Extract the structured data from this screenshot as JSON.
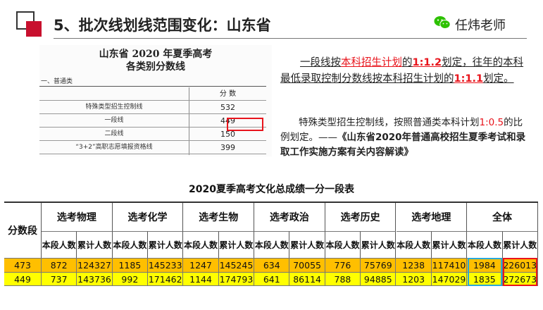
{
  "header": {
    "title": "5、批次线划线范围变化：山东省",
    "author": "任炜老师"
  },
  "doc": {
    "title_line1": "山东省 2020 年夏季高考",
    "title_line2": "各类别分数线",
    "section": "一、普通类",
    "col_header": "分 数",
    "rows": [
      {
        "label": "特殊类型招生控制线",
        "value": "532"
      },
      {
        "label": "一段线",
        "value": "449"
      },
      {
        "label": "二段线",
        "value": "150"
      },
      {
        "label": "“3+2”高职志愿填报资格线",
        "value": "399"
      }
    ]
  },
  "para1": {
    "t1": "一段线按",
    "t2": "本科招生计划",
    "t3": "的",
    "t4": "1:1.2",
    "t5": "划定，往年的本科最低录取控制分数线按本科招生计划的",
    "t6": "1:1.1",
    "t7": "划定。"
  },
  "para2": {
    "t1": "特殊类型招生控制线，按照普通类本科计划",
    "t2": "1:0.5",
    "t3": "的比例划定。——",
    "t4": "《山东省2020年普通高校招生夏季考试和录取工作实施方案有关内容解读》"
  },
  "table": {
    "title": "2020夏季高考文化总成绩一分一段表",
    "row_header": "分数段",
    "groups": [
      "选考物理",
      "选考化学",
      "选考生物",
      "选考政治",
      "选考历史",
      "选考地理",
      "全体"
    ],
    "sub_a": "本段人数",
    "sub_b": "累计人数",
    "rows": [
      {
        "score": "473",
        "cells": [
          "872",
          "124327",
          "1185",
          "145233",
          "1247",
          "145245",
          "634",
          "70055",
          "776",
          "75769",
          "1238",
          "117410",
          "1984",
          "226013"
        ]
      },
      {
        "score": "449",
        "cells": [
          "737",
          "143736",
          "992",
          "171462",
          "1144",
          "174793",
          "641",
          "86114",
          "788",
          "94885",
          "1203",
          "147029",
          "1835",
          "272673"
        ]
      }
    ]
  },
  "colors": {
    "accent_red": "#e8141c",
    "row1_bg": "#ffbf00",
    "row2_bg": "#ffff00",
    "highlight_blue": "#2aa8d8"
  }
}
